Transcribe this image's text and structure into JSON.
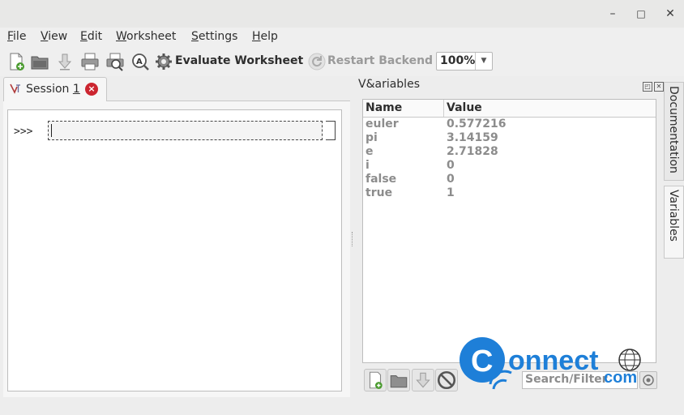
{
  "window": {
    "minimize": "–",
    "maximize": "□",
    "close": "✕"
  },
  "menu": [
    {
      "pre": "",
      "u": "F",
      "post": "ile"
    },
    {
      "pre": "",
      "u": "V",
      "post": "iew"
    },
    {
      "pre": "",
      "u": "E",
      "post": "dit"
    },
    {
      "pre": "",
      "u": "W",
      "post": "orksheet"
    },
    {
      "pre": "",
      "u": "S",
      "post": "ettings"
    },
    {
      "pre": "",
      "u": "H",
      "post": "elp"
    }
  ],
  "toolbar": {
    "evaluate_label": "Evaluate Worksheet",
    "restart_label": "Restart Backend",
    "zoom": "100%",
    "icons": [
      "new-worksheet-icon",
      "open-folder-icon",
      "save-icon",
      "print-icon",
      "print-preview-icon",
      "find-icon",
      "evaluate-gear-icon",
      "restart-icon"
    ]
  },
  "session_tab": {
    "label_pre": "Session ",
    "label_u": "1",
    "close": "×"
  },
  "worksheet": {
    "prompt": ">>>",
    "input": ""
  },
  "variables_panel": {
    "title": "V&ariables",
    "columns": [
      "Name",
      "Value"
    ],
    "rows": [
      {
        "name": "euler",
        "value": "0.577216"
      },
      {
        "name": "pi",
        "value": "3.14159"
      },
      {
        "name": "e",
        "value": "2.71828"
      },
      {
        "name": "i",
        "value": "0"
      },
      {
        "name": "false",
        "value": "0"
      },
      {
        "name": "true",
        "value": "1"
      }
    ],
    "search_placeholder": "Search/Filter"
  },
  "side_tabs": {
    "documentation": "Documentation",
    "variables": "Variables"
  },
  "watermark": {
    "text1": "onnect",
    "text2": "com",
    "letter": "C"
  },
  "colors": {
    "accent_blue": "#1e7fd8",
    "close_red": "#cc2630"
  }
}
